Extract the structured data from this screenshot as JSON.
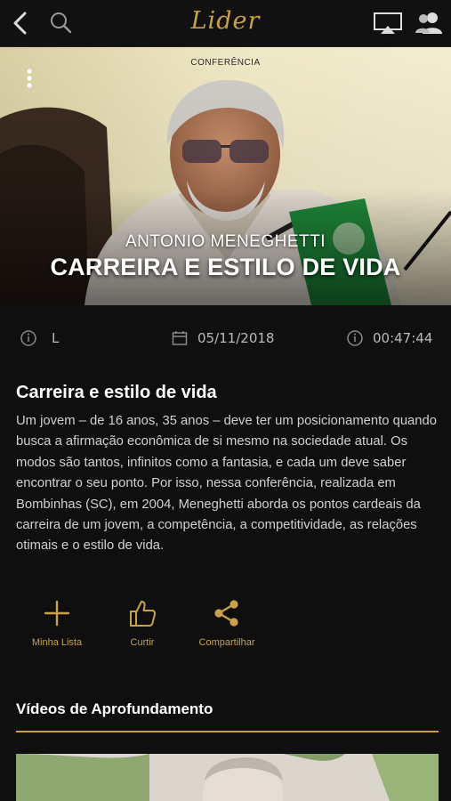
{
  "app": {
    "logo_text": "Lider",
    "brand_color": "#c9a14a"
  },
  "topbar": {
    "back_icon": "chevron-left-icon",
    "search_icon": "search-icon",
    "airplay_icon": "airplay-icon",
    "profiles_icon": "users-icon"
  },
  "hero": {
    "category": "CONFERÊNCIA",
    "speaker": "ANTONIO MENEGHETTI",
    "title": "CARREIRA E ESTILO DE VIDA",
    "menu_icon": "more-vertical-icon"
  },
  "meta": {
    "rating": "L",
    "date": "05/11/2018",
    "duration": "00:47:44"
  },
  "content": {
    "title": "Carreira e estilo de vida",
    "description": "Um jovem – de 16 anos, 35 anos – deve ter um posicionamento quando busca a afirmação econômica de si mesmo na sociedade atual. Os modos são tantos, infinitos como a fantasia, e cada um deve saber encontrar o seu ponto. Por isso, nessa conferência, realizada em Bombinhas (SC), em 2004, Meneghetti aborda os pontos cardeais da carreira de um jovem, a competência, a competitividade, as relações otimais e o estilo de vida."
  },
  "actions": [
    {
      "label": "Minha Lista",
      "icon": "plus-icon"
    },
    {
      "label": "Curtir",
      "icon": "thumbs-up-icon"
    },
    {
      "label": "Compartilhar",
      "icon": "share-icon"
    }
  ],
  "related": {
    "section_title": "Vídeos de Aprofundamento"
  }
}
